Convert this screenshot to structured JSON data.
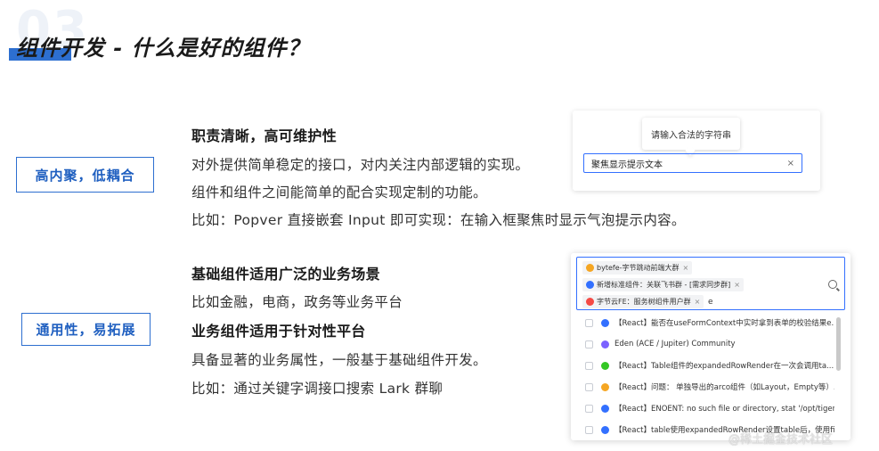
{
  "slide": {
    "number": "03",
    "title": "组件开发 - 什么是好的组件？"
  },
  "section1": {
    "tag": "高内聚，低耦合",
    "heading": "职责清晰，高可维护性",
    "line1": "对外提供简单稳定的接口，对内关注内部逻辑的实现。",
    "line2": "组件和组件之间能简单的配合实现定制的功能。",
    "line3": "比如：Popver 直接嵌套 Input 即可实现：在输入框聚焦时显示气泡提示内容。"
  },
  "section2": {
    "tag": "通用性，易拓展",
    "heading1": "基础组件适用广泛的业务场景",
    "line1": "比如金融，电商，政务等业务平台",
    "heading2": "业务组件适用于针对性平台",
    "line2": "具备显著的业务属性，一般基于基础组件开发。",
    "line3": "比如：通过关键字调接口搜索 Lark 群聊"
  },
  "popover_demo": {
    "bubble_text": "请输入合法的字符串",
    "input_value": "聚焦显示提示文本",
    "clear_icon": "×"
  },
  "select_demo": {
    "chips": [
      {
        "label": "bytefe-字节跳动前端大群",
        "icon_color": "#f5a623"
      },
      {
        "label": "新增标准组件：关联飞书群 - [需求同步群]",
        "icon_color": "#3370ff"
      },
      {
        "label": "字节云FE：服务树组件用户群",
        "icon_color": "#f54a45"
      }
    ],
    "chip_close": "×",
    "typed_text": "e",
    "options": [
      {
        "label": "【React】能否在useFormContext中实时拿到表单的校验结果e...",
        "icon_color": "#3370ff"
      },
      {
        "label": "Eden (ACE / Jupiter) Community",
        "icon_color": "#7b61ff"
      },
      {
        "label": "【React】Table组件的expandedRowRender在一次会调用ta...",
        "icon_color": "#34c724"
      },
      {
        "label": "【React】问题： 单独导出的arco组件（如Layout，Empty等）...",
        "icon_color": "#f5a623"
      },
      {
        "label": "【React】ENOENT: no such file or directory, stat '/opt/tiger/co...",
        "icon_color": "#3370ff"
      },
      {
        "label": "【React】table使用expandedRowRender设置table后，使用fix...",
        "icon_color": "#3370ff"
      }
    ]
  },
  "watermark": "@稀土掘金技术社区"
}
